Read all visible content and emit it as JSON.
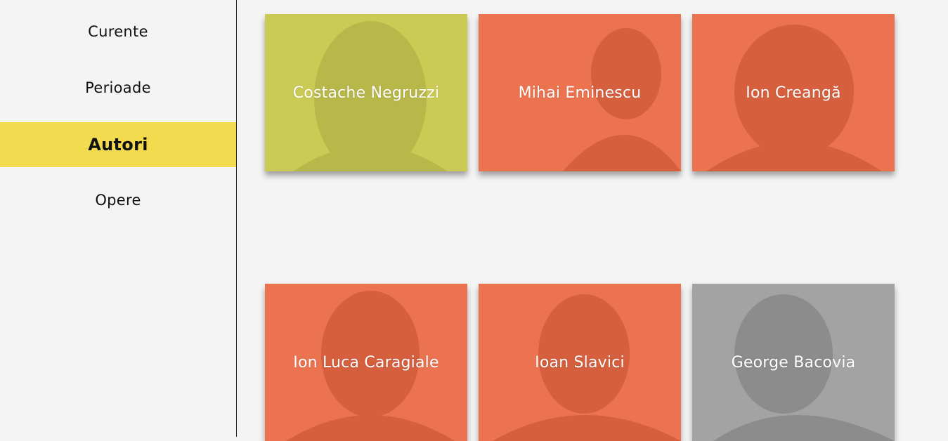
{
  "sidebar": {
    "items": [
      {
        "label": "Curente"
      },
      {
        "label": "Perioade"
      },
      {
        "label": "Autori"
      },
      {
        "label": "Opere"
      }
    ],
    "active_color": "#f2db4f"
  },
  "authors": [
    {
      "name": "Costache Negruzzi",
      "color": "#cbca55",
      "shade": "#b8b74a"
    },
    {
      "name": "Mihai Eminescu",
      "color": "#ec7350",
      "shade": "#d65f3e"
    },
    {
      "name": "Ion Creangă",
      "color": "#ec7350",
      "shade": "#d65f3e"
    },
    {
      "name": "Ion Luca Caragiale",
      "color": "#ec7350",
      "shade": "#d65f3e"
    },
    {
      "name": "Ioan Slavici",
      "color": "#ec7350",
      "shade": "#d65f3e"
    },
    {
      "name": "George Bacovia",
      "color": "#a3a3a3",
      "shade": "#8c8c8c"
    }
  ]
}
